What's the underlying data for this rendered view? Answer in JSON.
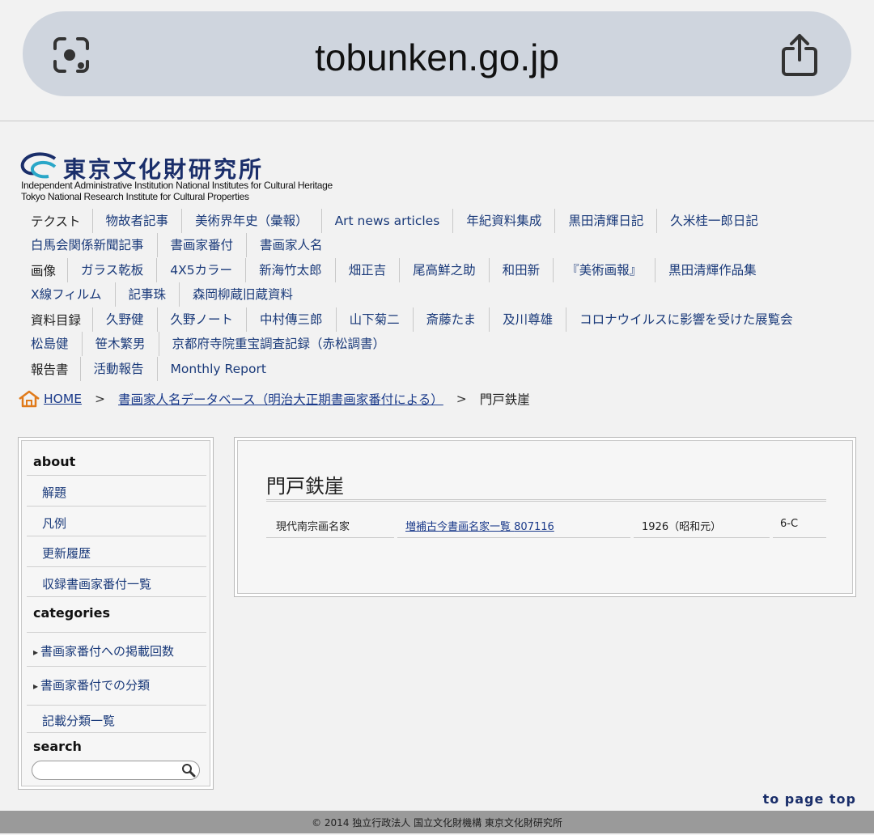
{
  "browser": {
    "url": "tobunken.go.jp"
  },
  "logo": {
    "name_jp": "東京文化財研究所",
    "name_en_1": "Independent Administrative Institution National Institutes for Cultural Heritage",
    "name_en_2": "Tokyo National Research Institute for Cultural Properties"
  },
  "nav": {
    "text": {
      "label": "テクスト",
      "items": [
        "物故者記事",
        "美術界年史（彙報）",
        "Art news articles",
        "年紀資料集成",
        "黒田清輝日記",
        "久米桂一郎日記"
      ],
      "items2": [
        "白馬会関係新聞記事",
        "書画家番付",
        "書画家人名"
      ]
    },
    "image": {
      "label": "画像",
      "items": [
        "ガラス乾板",
        "4X5カラー",
        "新海竹太郎",
        "畑正吉",
        "尾高鮮之助",
        "和田新",
        "『美術画報』",
        "黒田清輝作品集"
      ],
      "items2": [
        "X線フィルム",
        "記事珠",
        "森岡柳蔵旧蔵資料"
      ]
    },
    "catalog": {
      "label": "資料目録",
      "items": [
        "久野健",
        "久野ノート",
        "中村傳三郎",
        "山下菊二",
        "斎藤たま",
        "及川尊雄",
        "コロナウイルスに影響を受けた展覧会"
      ],
      "items2": [
        "松島健",
        "笹木繁男",
        "京都府寺院重宝調査記録（赤松調書）"
      ]
    },
    "report": {
      "label": "報告書",
      "items": [
        "活動報告",
        "Monthly Report"
      ]
    }
  },
  "breadcrumb": {
    "home": "HOME",
    "sep": ">",
    "level1": "書画家人名データベース（明治大正期書画家番付による）",
    "current": "門戸鉄崖"
  },
  "sidebar": {
    "about_head": "about",
    "about_items": [
      "解題",
      "凡例",
      "更新履歴",
      "収録書画家番付一覧"
    ],
    "categories_head": "categories",
    "categories_items": [
      "書画家番付への掲載回数",
      "書画家番付での分類"
    ],
    "categories_link": "記載分類一覧",
    "search_head": "search"
  },
  "main": {
    "title": "門戸鉄崖",
    "row": {
      "category": "現代南宗画名家",
      "source_name": "増補古今書画名家一覧",
      "source_id": "807116",
      "year": "1926（昭和元）",
      "position": "6-C"
    }
  },
  "page_top": "to page top",
  "footer": "© 2014 独立行政法人 国立文化財機構 東京文化財研究所"
}
